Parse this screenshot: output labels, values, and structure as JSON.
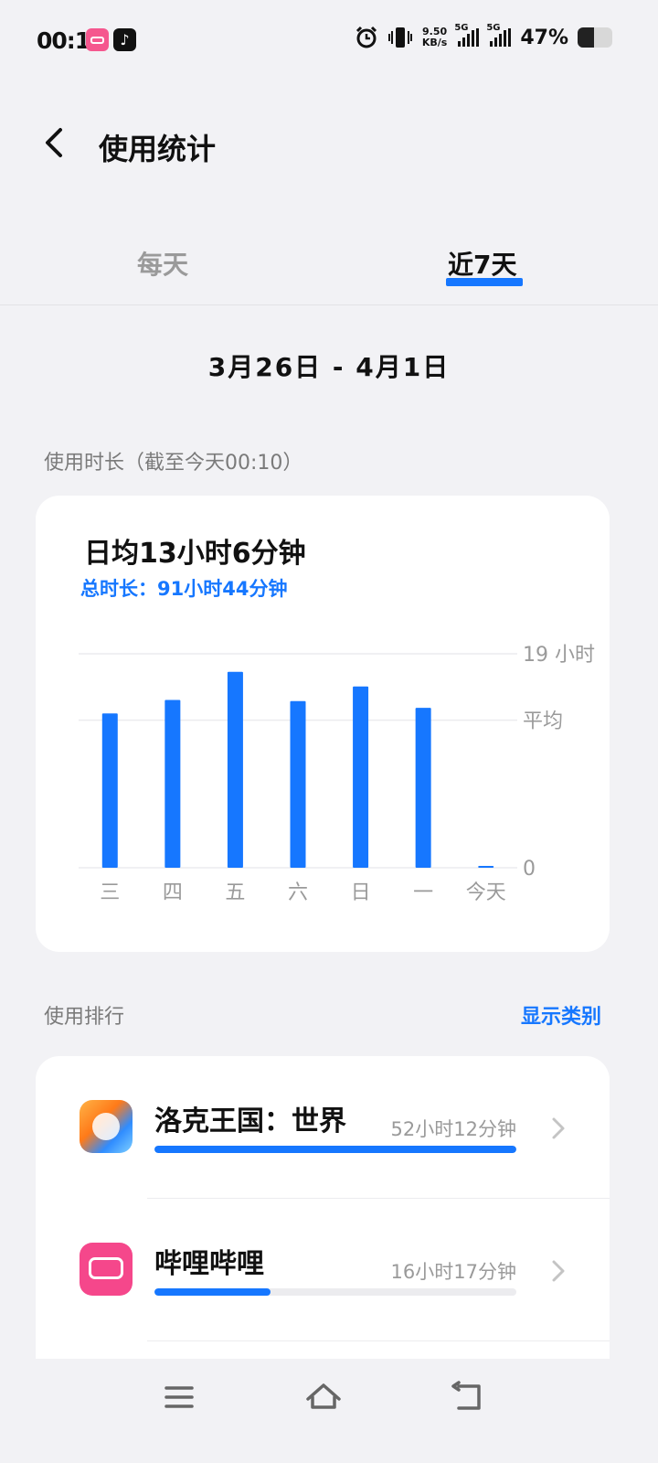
{
  "status_bar": {
    "time": "00:11",
    "net_speed_value": "9.50",
    "net_speed_unit": "KB/s",
    "sim1_label": "5G",
    "sim2_label": "5G",
    "battery_percent_text": "47%",
    "battery_level": 0.47
  },
  "header": {
    "title": "使用统计"
  },
  "tabs": {
    "daily": "每天",
    "week": "近7天"
  },
  "date_range": "3月26日 - 4月1日",
  "usage_section": {
    "label": "使用时长（截至今天00:10）",
    "daily_average": "日均13小时6分钟",
    "total": "总时长：91小时44分钟"
  },
  "chart_data": {
    "type": "bar",
    "categories": [
      "三",
      "四",
      "五",
      "六",
      "日",
      "一",
      "今天"
    ],
    "values": [
      13.7,
      14.9,
      17.4,
      14.8,
      16.1,
      14.2,
      0.1
    ],
    "ylim": [
      0,
      19
    ],
    "y_tick_labels": [
      "19 小时",
      "平均",
      "0"
    ],
    "average_value": 13.1,
    "grid": true,
    "bar_color": "#1677ff"
  },
  "ranking_section": {
    "label": "使用排行",
    "show_category": "显示类别",
    "apps": [
      {
        "name": "洛克王国：世界",
        "duration": "52小时12分钟",
        "share": 1.0
      },
      {
        "name": "哔哩哔哩",
        "duration": "16小时17分钟",
        "share": 0.32
      }
    ]
  },
  "colors": {
    "accent": "#1677ff",
    "background": "#f2f2f5",
    "card": "#ffffff"
  },
  "icons": {
    "back": "chevron-left-icon",
    "row_arrow": "chevron-right-icon",
    "nav_menu": "menu-icon",
    "nav_home": "home-icon",
    "nav_back": "back-icon"
  }
}
